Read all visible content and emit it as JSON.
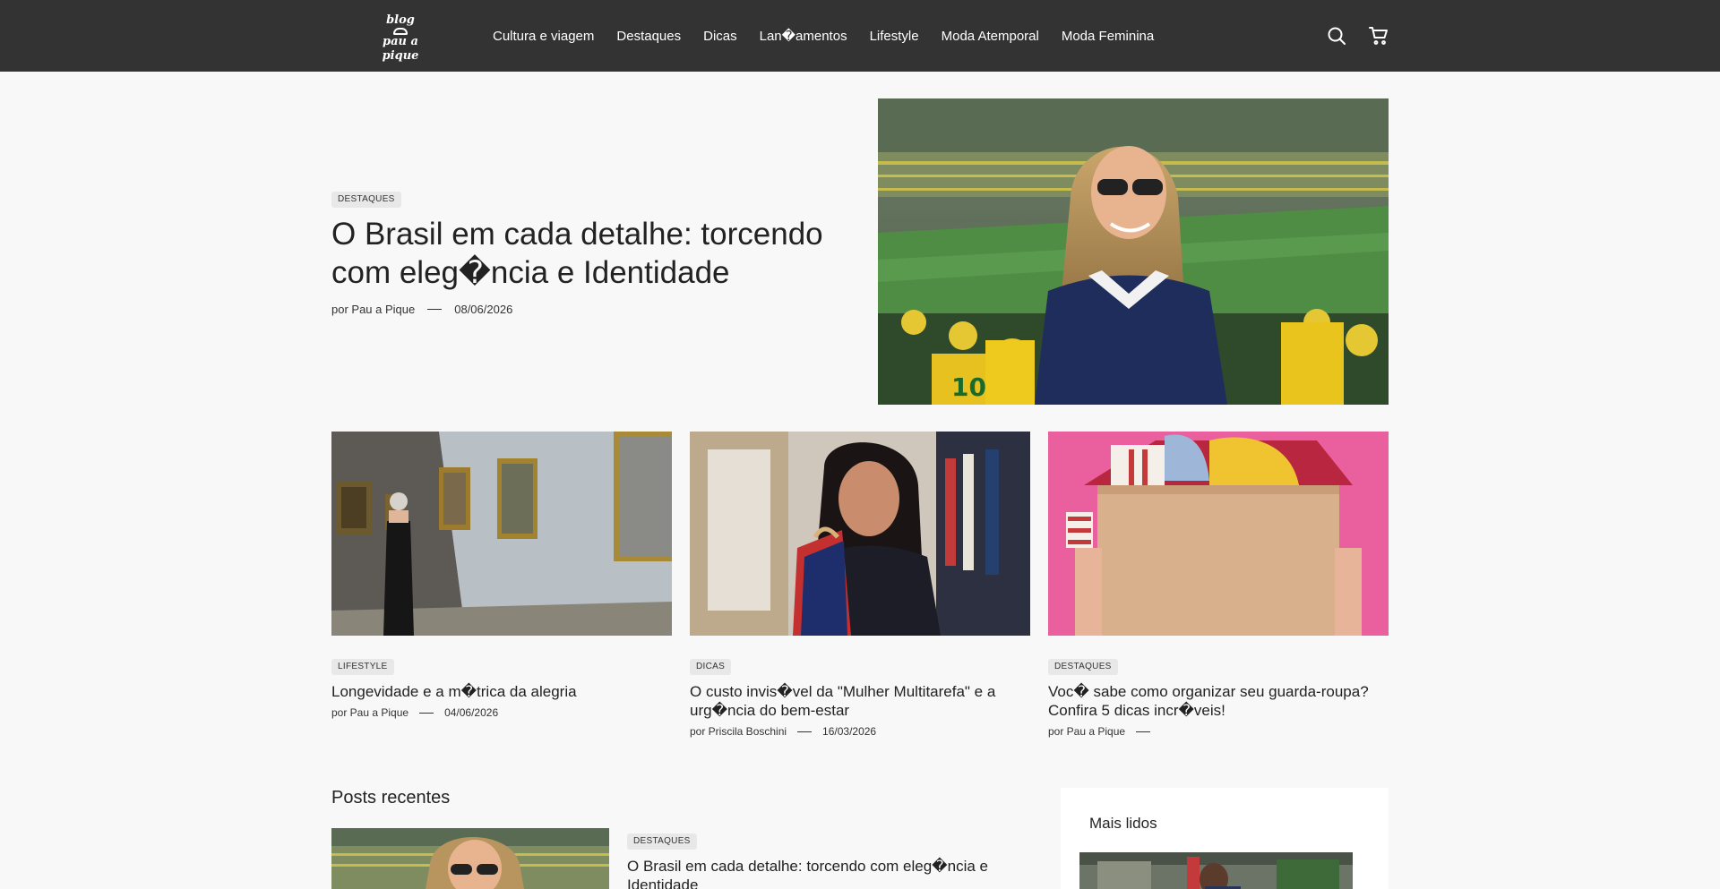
{
  "header": {
    "logo": {
      "line1": "blog",
      "line2": "pau a pique"
    },
    "nav": [
      "Cultura e viagem",
      "Destaques",
      "Dicas",
      "Lan�amentos",
      "Lifestyle",
      "Moda Atemporal",
      "Moda Feminina"
    ],
    "icons": {
      "search": "search-icon",
      "cart": "cart-icon"
    }
  },
  "hero": {
    "tag": "DESTAQUES",
    "title": "O Brasil em cada detalhe: torcendo com eleg�ncia e Identidade",
    "author": "por Pau a Pique",
    "date": "08/06/2026"
  },
  "cards": [
    {
      "tag": "LIFESTYLE",
      "title": "Longevidade e a m�trica da alegria",
      "author": "por Pau a Pique",
      "date": "04/06/2026"
    },
    {
      "tag": "DICAS",
      "title": "O custo invis�vel da \"Mulher Multitarefa\" e a urg�ncia do bem-estar",
      "author": "por Priscila Boschini",
      "date": "16/03/2026"
    },
    {
      "tag": "DESTAQUES",
      "title": "Voc� sabe como organizar seu guarda-roupa? Confira 5 dicas incr�veis!",
      "author": "por Pau a Pique",
      "date": ""
    }
  ],
  "recent": {
    "heading": "Posts recentes",
    "tag": "DESTAQUES",
    "title": "O Brasil em cada detalhe: torcendo com eleg�ncia e Identidade"
  },
  "sidebar": {
    "heading": "Mais lidos"
  },
  "colors": {
    "header_bg": "#333333",
    "page_bg": "#f8f8f8",
    "tag_bg": "#e8e8e8",
    "pink_bg": "#ea5f9e"
  }
}
